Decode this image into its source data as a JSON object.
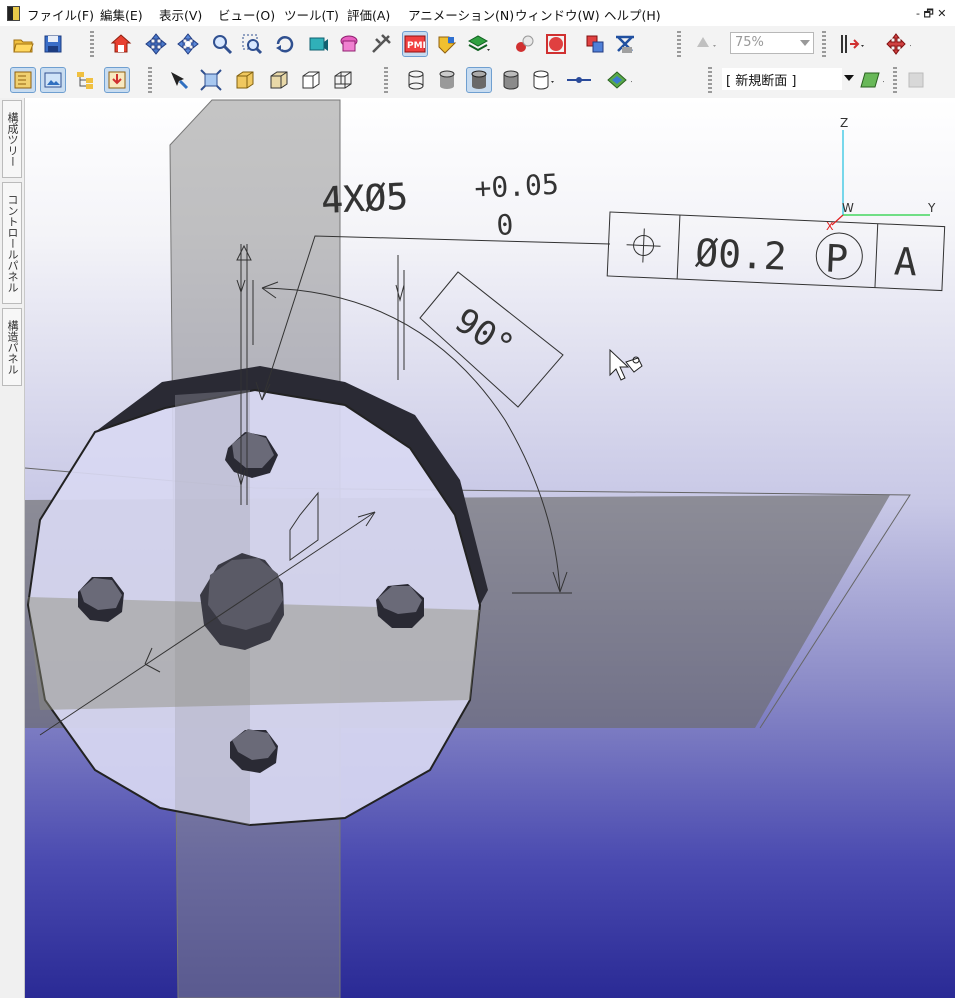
{
  "menu": {
    "items": [
      "ファイル(F)",
      "編集(E)",
      "表示(V)",
      "ビュー(O)",
      "ツール(T)",
      "評価(A)",
      "アニメーション(N)",
      "ウィンドウ(W)",
      "ヘルプ(H)"
    ],
    "window_controls": "- 🗗 ✕"
  },
  "toolbar": {
    "zoom_value": "75%",
    "section_select": "[ 新規断面 ]"
  },
  "side_tabs": [
    "構成ツリー",
    "コントロールパネル",
    "構造パネル"
  ],
  "annotation": {
    "dimension_main": "4XØ5",
    "tol_upper": "+0.05",
    "tol_lower": "0",
    "fcf_symbol": "⌖",
    "fcf_tolerance": "Ø0.2",
    "fcf_modifier": "P",
    "fcf_datum": "A",
    "angle": "90°",
    "datum_tag": "A"
  },
  "triad": {
    "z_label": "Z",
    "y_label": "Y",
    "w_label": "W",
    "x_label": "X"
  },
  "colors": {
    "triad_z": "#20c0e0",
    "triad_y": "#20d040",
    "triad_x": "#e02020"
  }
}
